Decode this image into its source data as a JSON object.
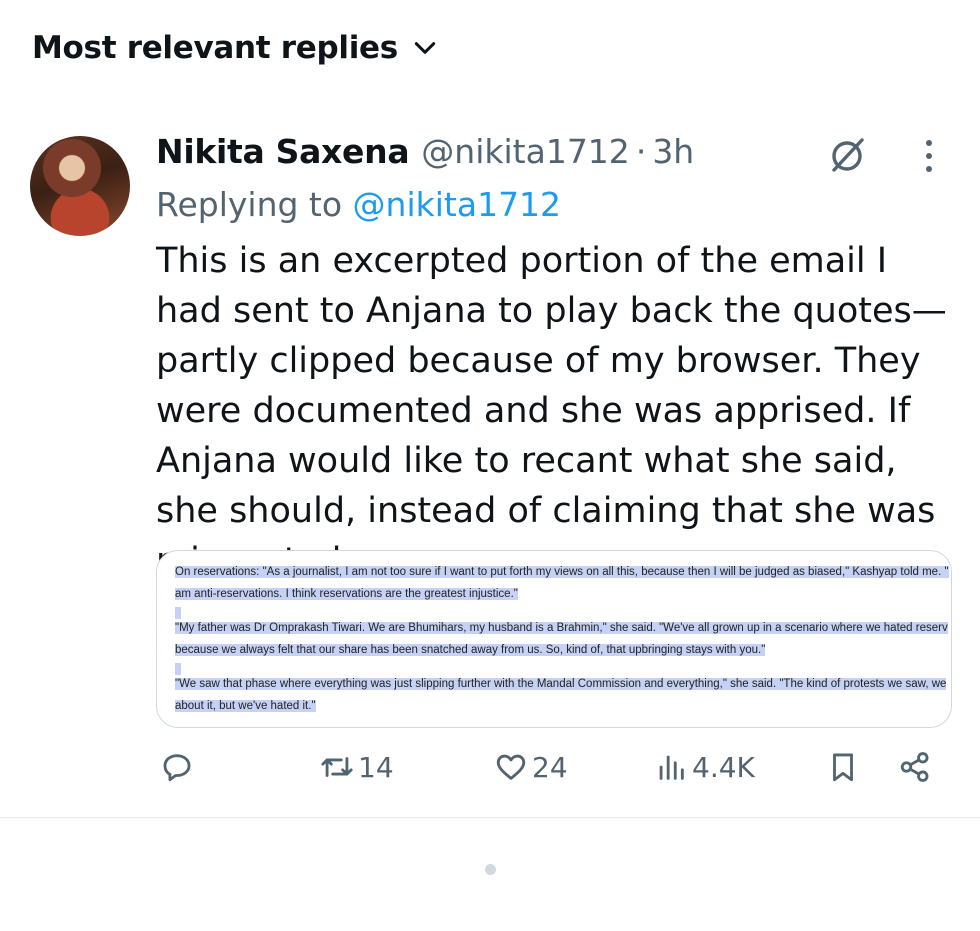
{
  "header": {
    "sort_label": "Most relevant replies"
  },
  "tweet": {
    "author_name": "Nikita Saxena",
    "handle": "@nikita1712",
    "separator": "·",
    "time": "3h",
    "replying_prefix": "Replying to",
    "replying_handle": "@nikita1712",
    "text": "This is an excerpted portion of the email I had sent to Anjana to play back the quotes—partly clipped because of my browser. They were documented and she was apprised. If Anjana would like to recant what she said, she should, instead of claiming that she was misquoted."
  },
  "media": {
    "lines": [
      "On reservations: \"As a journalist, I am not too sure if I want to put forth my views on all this, because then I will be judged as biased,\" Kashyap told me. \"",
      "am anti-reservations. I think reservations are the greatest injustice.\"",
      "\"My father was Dr Omprakash Tiwari. We are Bhumihars, my husband is a Brahmin,\" she said. \"We've all grown up in a scenario where we hated reserv",
      "because we always felt that our share has been snatched away from us. So, kind of, that upbringing stays with you.\"",
      "\"We saw that phase where everything was just slipping further with the Mandal Commission and everything,\" she said. \"The kind of protests we saw, we",
      "about it, but we've hated it.\""
    ]
  },
  "actions": {
    "reply_count": "",
    "retweet_count": "14",
    "like_count": "24",
    "view_count": "4.4K"
  },
  "icons": {
    "sort": "chevron-down-icon",
    "grok": "grok-icon",
    "more": "more-vertical-icon",
    "reply": "reply-icon",
    "retweet": "retweet-icon",
    "like": "heart-icon",
    "views": "views-icon",
    "bookmark": "bookmark-icon",
    "share": "share-icon"
  },
  "colors": {
    "accent": "#1d9bf0",
    "secondary_text": "#536471",
    "highlight": "#c5d2f5"
  }
}
